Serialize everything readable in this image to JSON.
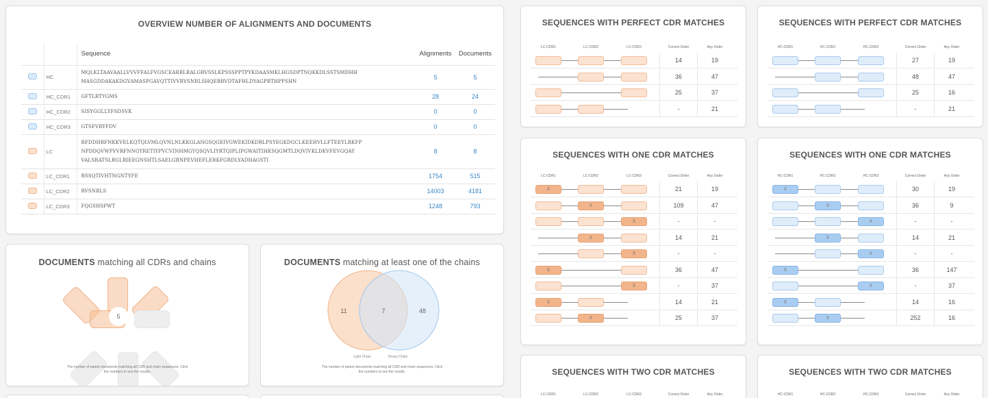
{
  "overview": {
    "title": "OVERVIEW NUMBER OF ALIGNMENTS AND DOCUMENTS",
    "headers": {
      "sequence": "Sequence",
      "alignments": "Alignments",
      "documents": "Documents"
    },
    "colors": {
      "heavy": "#dcebfa",
      "light": "#fbe0cc",
      "link": "#3a86c6"
    },
    "rows": [
      {
        "chain": "heavy",
        "name": "HC",
        "seq1": "MQLKLTAAVAALLVVVFFALFVGSCEARRLRALGRVSSLKPSSSPPTPYKDAASMKLHGSDPTNQKKDLSSTSMDHH",
        "seq2": "MASGDDAKAKDGVAMASPGAVQTTIVVRVSNRLSHQERRVDTAFHLDYAGPRTHPPSHN",
        "seq3": "",
        "alignments": "5",
        "documents": "5"
      },
      {
        "chain": "heavy",
        "name": "HC_CDR1",
        "seq1": "GFTLRTYGMS",
        "seq2": "",
        "seq3": "",
        "alignments": "28",
        "documents": "24"
      },
      {
        "chain": "heavy",
        "name": "HC_CDR2",
        "seq1": "SISYGGLLYFSDSVK",
        "seq2": "",
        "seq3": "",
        "alignments": "0",
        "documents": "0"
      },
      {
        "chain": "heavy",
        "name": "HC_CDR3",
        "seq1": "GTSFVRYFDV",
        "seq2": "",
        "seq3": "",
        "alignments": "0",
        "documents": "0"
      },
      {
        "chain": "light",
        "name": "LC",
        "seq1": "RFDDHRFNKKVELKQTQLVMLQVNLNLKKGLANGSQGEIVGWEKIDKDRLPSYEGKDGCLKEEHVLLFTEEYLRKFP",
        "seq2": "NPDDQVWPVVRFNNGYRETIYPVCVINHMGYQSQVLIYRTQIPLIPGWAITIHKSQGMTLDQVIVKLDKVFEVGQAY",
        "seq3": "VALSRATSLRGLRIEEGNSHTLSAELGRNPEVHEFLERKFGRDLYADHAGSTI",
        "alignments": "8",
        "documents": "8"
      },
      {
        "chain": "light",
        "name": "LC_CDR1",
        "seq1": "RSSQTIVHTNGNTYFE",
        "seq2": "",
        "seq3": "",
        "alignments": "1754",
        "documents": "515"
      },
      {
        "chain": "light",
        "name": "LC_CDR2",
        "seq1": "RVSNRLS",
        "seq2": "",
        "seq3": "",
        "alignments": "14003",
        "documents": "4181"
      },
      {
        "chain": "light",
        "name": "LC_CDR3",
        "seq1": "FQGSHSPWT",
        "seq2": "",
        "seq3": "",
        "alignments": "1248",
        "documents": "793"
      }
    ]
  },
  "docs_all": {
    "title_bold": "DOCUMENTS",
    "title_rest": "matching all CDRs and chains",
    "center_value": "5",
    "caption_line1": "The number of patent documents matching all CDR and chain sequences. Click",
    "caption_line2": "the numbers to see the results."
  },
  "docs_one": {
    "title_bold": "DOCUMENTS",
    "title_rest": "matching at least one of the chains",
    "left_only": "11",
    "both": "7",
    "right_only": "48",
    "left_label": "Light Chain",
    "right_label": "Heavy Chain",
    "caption_line1": "The number of patent documents matching all CDR and chain sequences. Click",
    "caption_line2": "the numbers to see the results.",
    "colors": {
      "light": "#f7c7a3",
      "heavy": "#cfe3f8"
    }
  },
  "seq_cards": {
    "lc_perfect": {
      "title": "SEQUENCES WITH PERFECT CDR MATCHES",
      "headers": [
        "LC-CDR1",
        "LC-CDR2",
        "LC-CDR3",
        "Correct Order",
        "Any Order"
      ],
      "rows": [
        {
          "correct": "14",
          "any": "19"
        },
        {
          "correct": "36",
          "any": "47"
        },
        {
          "correct": "25",
          "any": "37"
        },
        {
          "correct": "-",
          "any": "21"
        }
      ]
    },
    "hc_perfect": {
      "title": "SEQUENCES WITH PERFECT CDR MATCHES",
      "headers": [
        "HC-CDR1",
        "HC-CDR2",
        "HC-CDR3",
        "Correct Order",
        "Any Order"
      ],
      "rows": [
        {
          "correct": "27",
          "any": "19"
        },
        {
          "correct": "48",
          "any": "47"
        },
        {
          "correct": "25",
          "any": "16"
        },
        {
          "correct": "-",
          "any": "21"
        }
      ]
    },
    "lc_one": {
      "title": "SEQUENCES WITH ONE CDR MATCHES",
      "headers": [
        "LC-CDR1",
        "LC-CDR2",
        "LC-CDR3",
        "Correct Order",
        "Any Order"
      ],
      "mark": "X",
      "rows": [
        {
          "correct": "21",
          "any": "19"
        },
        {
          "correct": "109",
          "any": "47"
        },
        {
          "correct": "-",
          "any": "-"
        },
        {
          "correct": "14",
          "any": "21"
        },
        {
          "correct": "-",
          "any": "-"
        },
        {
          "correct": "36",
          "any": "47"
        },
        {
          "correct": "-",
          "any": "37"
        },
        {
          "correct": "14",
          "any": "21"
        },
        {
          "correct": "25",
          "any": "37"
        }
      ]
    },
    "hc_one": {
      "title": "SEQUENCES WITH ONE CDR MATCHES",
      "headers": [
        "HC-CDR1",
        "HC-CDR2",
        "HC-CDR3",
        "Correct Order",
        "Any Order"
      ],
      "mark": "X",
      "rows": [
        {
          "correct": "30",
          "any": "19"
        },
        {
          "correct": "36",
          "any": "9"
        },
        {
          "correct": "-",
          "any": "-"
        },
        {
          "correct": "14",
          "any": "21"
        },
        {
          "correct": "-",
          "any": "-"
        },
        {
          "correct": "36",
          "any": "147"
        },
        {
          "correct": "-",
          "any": "37"
        },
        {
          "correct": "14",
          "any": "16"
        },
        {
          "correct": "252",
          "any": "16"
        }
      ]
    },
    "lc_two": {
      "title": "SEQUENCES WITH TWO CDR MATCHES",
      "headers": [
        "LC-CDR1",
        "LC-CDR2",
        "LC-CDR3",
        "Correct Order",
        "Any Order"
      ]
    },
    "hc_two": {
      "title": "SEQUENCES WITH TWO CDR MATCHES",
      "headers": [
        "HC-CDR1",
        "HC-CDR2",
        "HC-CDR3",
        "Correct Order",
        "Any Order"
      ]
    }
  }
}
